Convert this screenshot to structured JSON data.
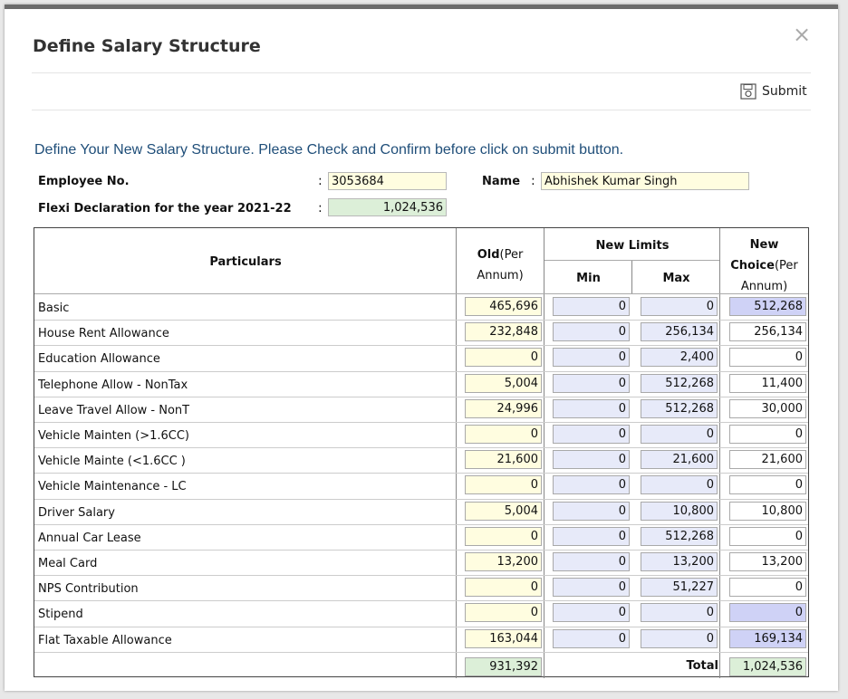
{
  "dialog": {
    "title": "Define Salary Structure",
    "close_glyph": "×",
    "submit_label": "Submit",
    "instruction": "Define Your New Salary Structure. Please Check and Confirm before click on submit button."
  },
  "employee": {
    "emp_no_label": "Employee No.",
    "emp_no": "3053684",
    "name_label": "Name",
    "name": "Abhishek Kumar Singh",
    "flexi_label": "Flexi Declaration for the year 2021-22",
    "flexi_value": "1,024,536",
    "colon": ":"
  },
  "table": {
    "headers": {
      "particulars": "Particulars",
      "old_bold": "Old",
      "old_rest": "(Per",
      "old_line2": "Annum)",
      "new_limits": "New Limits",
      "min": "Min",
      "max": "Max",
      "new_line1": "New",
      "new_bold": "Choice",
      "new_rest": "(Per",
      "new_line3": "Annum)"
    },
    "rows": [
      {
        "particular": "Basic",
        "old": "465,696",
        "min": "0",
        "max": "0",
        "new": "512,268",
        "new_highlight": true
      },
      {
        "particular": "House Rent Allowance",
        "old": "232,848",
        "min": "0",
        "max": "256,134",
        "new": "256,134",
        "new_highlight": false
      },
      {
        "particular": "Education Allowance",
        "old": "0",
        "min": "0",
        "max": "2,400",
        "new": "0",
        "new_highlight": false
      },
      {
        "particular": "Telephone Allow - NonTax",
        "old": "5,004",
        "min": "0",
        "max": "512,268",
        "new": "11,400",
        "new_highlight": false
      },
      {
        "particular": "Leave Travel Allow - NonT",
        "old": "24,996",
        "min": "0",
        "max": "512,268",
        "new": "30,000",
        "new_highlight": false
      },
      {
        "particular": "Vehicle Mainten (>1.6CC)",
        "old": "0",
        "min": "0",
        "max": "0",
        "new": "0",
        "new_highlight": false
      },
      {
        "particular": "Vehicle Mainte (<1.6CC )",
        "old": "21,600",
        "min": "0",
        "max": "21,600",
        "new": "21,600",
        "new_highlight": false
      },
      {
        "particular": "Vehicle Maintenance - LC",
        "old": "0",
        "min": "0",
        "max": "0",
        "new": "0",
        "new_highlight": false
      },
      {
        "particular": "Driver Salary",
        "old": "5,004",
        "min": "0",
        "max": "10,800",
        "new": "10,800",
        "new_highlight": false
      },
      {
        "particular": "Annual Car Lease",
        "old": "0",
        "min": "0",
        "max": "512,268",
        "new": "0",
        "new_highlight": false
      },
      {
        "particular": "Meal Card",
        "old": "13,200",
        "min": "0",
        "max": "13,200",
        "new": "13,200",
        "new_highlight": false
      },
      {
        "particular": "NPS Contribution",
        "old": "0",
        "min": "0",
        "max": "51,227",
        "new": "0",
        "new_highlight": false
      },
      {
        "particular": "Stipend",
        "old": "0",
        "min": "0",
        "max": "0",
        "new": "0",
        "new_highlight": true
      },
      {
        "particular": "Flat Taxable Allowance",
        "old": "163,044",
        "min": "0",
        "max": "0",
        "new": "169,134",
        "new_highlight": true
      }
    ],
    "total_label": "Total",
    "old_total": "931,392",
    "new_total": "1,024,536"
  }
}
